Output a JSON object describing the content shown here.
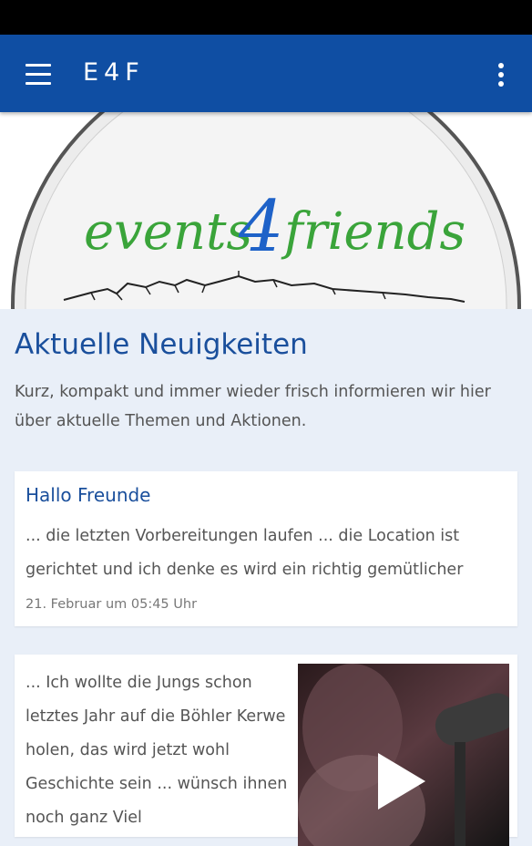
{
  "app": {
    "title": "E4F"
  },
  "header": {
    "menu_icon": "hamburger-menu-icon",
    "more_icon": "more-vert-icon"
  },
  "hero": {
    "logo_word1": "events",
    "logo_number": "4",
    "logo_word2": "friends"
  },
  "intro": {
    "heading": "Aktuelle Neuigkeiten",
    "text": "Kurz, kompakt und immer wieder frisch informieren wir hier über aktuelle Themen und Aktionen."
  },
  "posts": [
    {
      "title": "Hallo Freunde",
      "excerpt": "... die letzten Vorbereitungen laufen ... die Location ist gerichtet und ich denke es wird ein richtig gemütlicher",
      "date": "21. Februar um 05:45 Uhr"
    },
    {
      "excerpt": "... Ich wollte die Jungs schon letztes Jahr auf die Böhler Kerwe holen, das wird jetzt wohl Geschichte sein ... wünsch ihnen noch ganz Viel",
      "video_icon": "play-icon"
    }
  ],
  "colors": {
    "appbar": "#0f4ea3",
    "heading": "#1a4f9c",
    "logo_green": "#3aa43a",
    "logo_blue": "#1e62c8",
    "background": "#e9eff8"
  }
}
